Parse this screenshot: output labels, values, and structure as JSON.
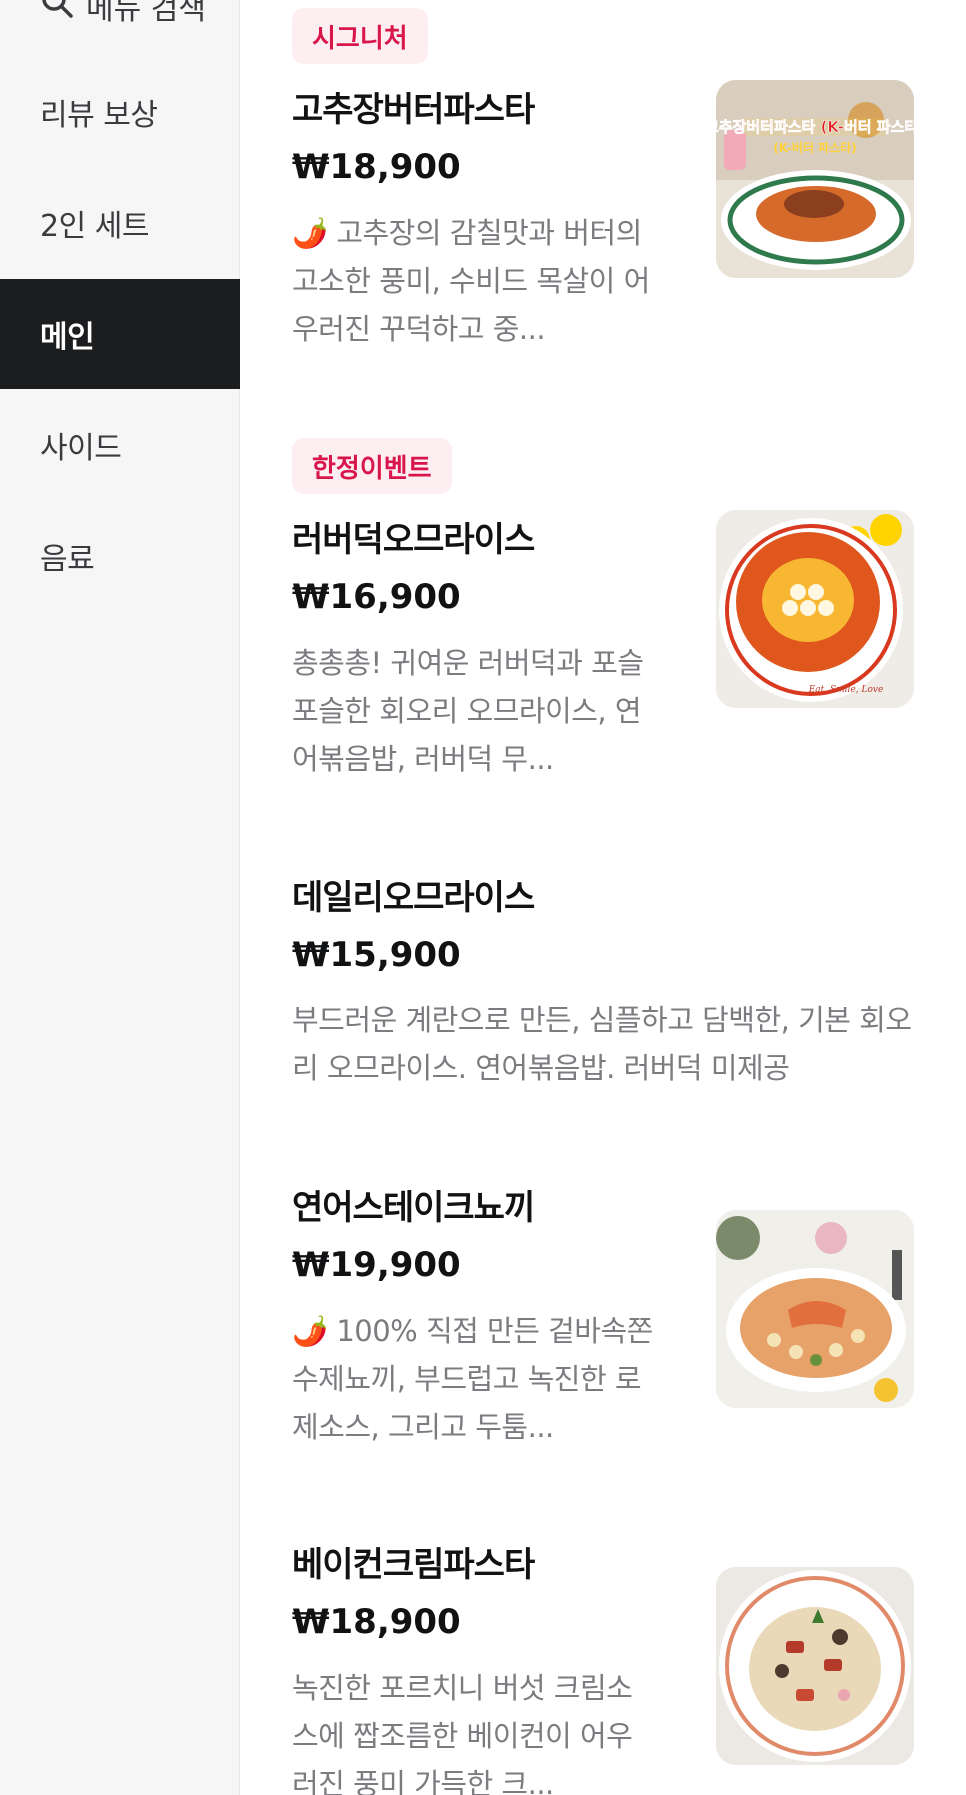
{
  "sidebar": {
    "search_label": "메뉴 검색",
    "items": [
      {
        "label": "리뷰 보상",
        "active": false
      },
      {
        "label": "2인 세트",
        "active": false
      },
      {
        "label": "메인",
        "active": true
      },
      {
        "label": "사이드",
        "active": false
      },
      {
        "label": "음료",
        "active": false
      }
    ]
  },
  "menu": {
    "items": [
      {
        "badge": "시그니처",
        "name": "고추장버터파스타",
        "price": "₩18,900",
        "description": "🌶️ 고추장의 감칠맛과 버터의 고소한 풍미, 수비드 목살이 어우러진 꾸덕하고 중...",
        "image_icon": "gochujang-butter-pasta-photo",
        "image_text": "고추장버터파스타 (K-버터 파스타)"
      },
      {
        "badge": "한정이벤트",
        "name": "러버덕오므라이스",
        "price": "₩16,900",
        "description": "총총총! 귀여운 러버덕과 포슬포슬한 회오리 오므라이스, 연어볶음밥, 러버덕 무...",
        "image_icon": "rubber-duck-omurice-photo",
        "image_text": "Eat, Smile, Love"
      },
      {
        "badge": "",
        "name": "데일리오므라이스",
        "price": "₩15,900",
        "description": "부드러운 계란으로 만든, 심플하고 담백한, 기본 회오리 오므라이스. 연어볶음밥. 러버덕 미제공",
        "image_icon": "",
        "image_text": ""
      },
      {
        "badge": "",
        "name": "연어스테이크뇨끼",
        "price": "₩19,900",
        "description": "🌶️ 100% 직접 만든 겉바속쫀 수제뇨끼, 부드럽고 녹진한 로제소스, 그리고 두툼...",
        "image_icon": "salmon-steak-gnocchi-photo",
        "image_text": ""
      },
      {
        "badge": "",
        "name": "베이컨크림파스타",
        "price": "₩18,900",
        "description": "녹진한 포르치니 버섯 크림소스에 짭조름한 베이컨이 어우러진 풍미 가득한 크...",
        "image_icon": "bacon-cream-pasta-photo",
        "image_text": ""
      }
    ]
  }
}
